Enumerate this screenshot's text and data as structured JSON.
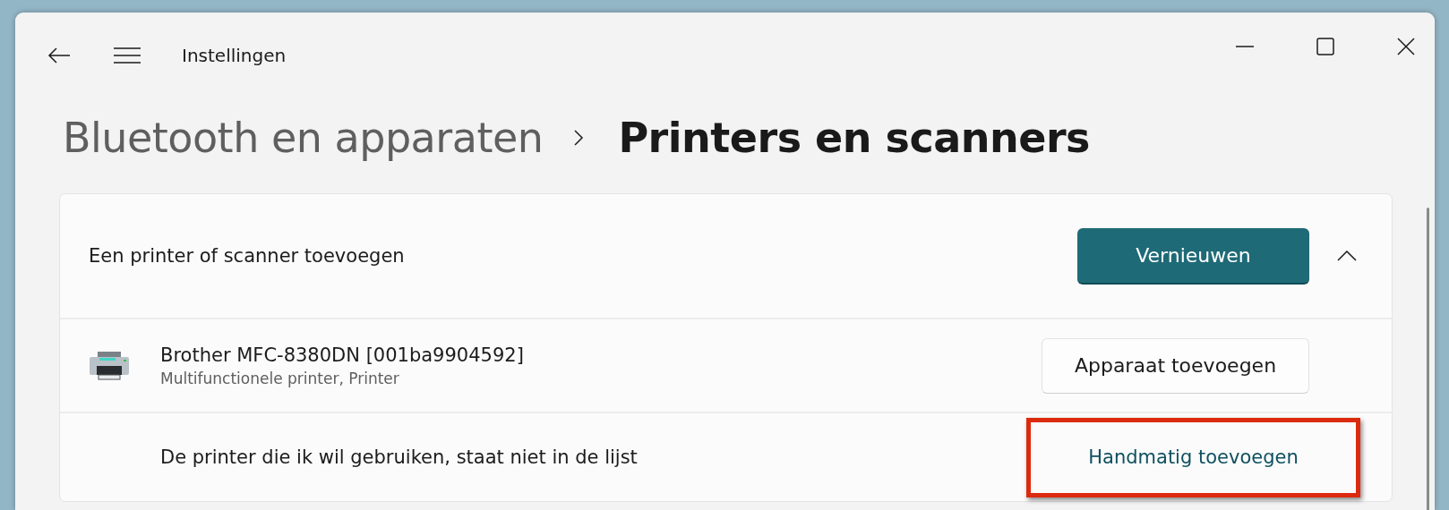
{
  "window": {
    "title": "Instellingen"
  },
  "breadcrumb": [
    {
      "label": "Bluetooth en apparaten",
      "current": false
    },
    {
      "label": "Printers en scanners",
      "current": true
    }
  ],
  "add_section": {
    "label": "Een printer of scanner toevoegen",
    "refresh_button": "Vernieuwen",
    "expanded": true,
    "devices": [
      {
        "name": "Brother MFC-8380DN [001ba9904592]",
        "description": "Multifunctionele printer, Printer",
        "button": "Apparaat toevoegen"
      }
    ],
    "manual": {
      "text": "De printer die ik wil gebruiken, staat niet in de lijst",
      "link": "Handmatig toevoegen",
      "highlighted": true
    }
  }
}
